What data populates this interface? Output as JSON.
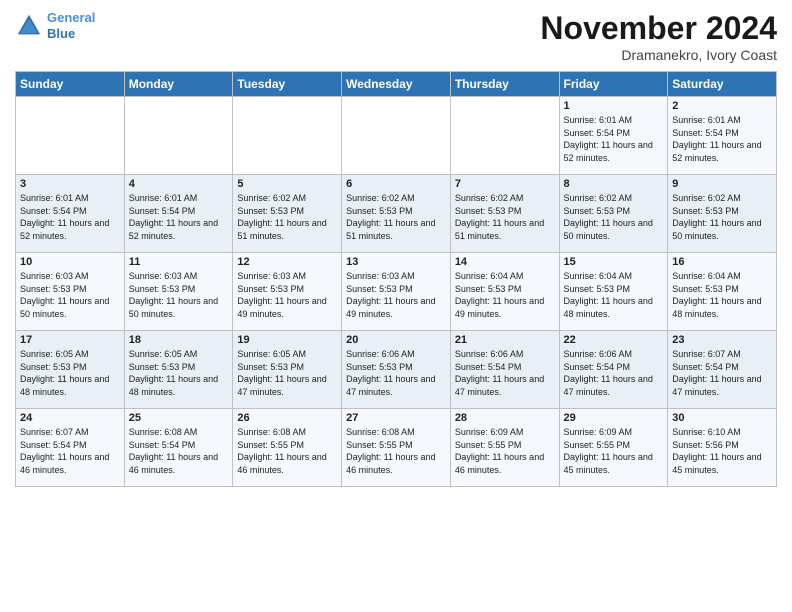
{
  "logo": {
    "line1": "General",
    "line2": "Blue"
  },
  "title": "November 2024",
  "subtitle": "Dramanekro, Ivory Coast",
  "days_of_week": [
    "Sunday",
    "Monday",
    "Tuesday",
    "Wednesday",
    "Thursday",
    "Friday",
    "Saturday"
  ],
  "weeks": [
    [
      {
        "day": "",
        "sunrise": "",
        "sunset": "",
        "daylight": ""
      },
      {
        "day": "",
        "sunrise": "",
        "sunset": "",
        "daylight": ""
      },
      {
        "day": "",
        "sunrise": "",
        "sunset": "",
        "daylight": ""
      },
      {
        "day": "",
        "sunrise": "",
        "sunset": "",
        "daylight": ""
      },
      {
        "day": "",
        "sunrise": "",
        "sunset": "",
        "daylight": ""
      },
      {
        "day": "1",
        "sunrise": "6:01 AM",
        "sunset": "5:54 PM",
        "daylight": "11 hours and 52 minutes."
      },
      {
        "day": "2",
        "sunrise": "6:01 AM",
        "sunset": "5:54 PM",
        "daylight": "11 hours and 52 minutes."
      }
    ],
    [
      {
        "day": "3",
        "sunrise": "6:01 AM",
        "sunset": "5:54 PM",
        "daylight": "11 hours and 52 minutes."
      },
      {
        "day": "4",
        "sunrise": "6:01 AM",
        "sunset": "5:54 PM",
        "daylight": "11 hours and 52 minutes."
      },
      {
        "day": "5",
        "sunrise": "6:02 AM",
        "sunset": "5:53 PM",
        "daylight": "11 hours and 51 minutes."
      },
      {
        "day": "6",
        "sunrise": "6:02 AM",
        "sunset": "5:53 PM",
        "daylight": "11 hours and 51 minutes."
      },
      {
        "day": "7",
        "sunrise": "6:02 AM",
        "sunset": "5:53 PM",
        "daylight": "11 hours and 51 minutes."
      },
      {
        "day": "8",
        "sunrise": "6:02 AM",
        "sunset": "5:53 PM",
        "daylight": "11 hours and 50 minutes."
      },
      {
        "day": "9",
        "sunrise": "6:02 AM",
        "sunset": "5:53 PM",
        "daylight": "11 hours and 50 minutes."
      }
    ],
    [
      {
        "day": "10",
        "sunrise": "6:03 AM",
        "sunset": "5:53 PM",
        "daylight": "11 hours and 50 minutes."
      },
      {
        "day": "11",
        "sunrise": "6:03 AM",
        "sunset": "5:53 PM",
        "daylight": "11 hours and 50 minutes."
      },
      {
        "day": "12",
        "sunrise": "6:03 AM",
        "sunset": "5:53 PM",
        "daylight": "11 hours and 49 minutes."
      },
      {
        "day": "13",
        "sunrise": "6:03 AM",
        "sunset": "5:53 PM",
        "daylight": "11 hours and 49 minutes."
      },
      {
        "day": "14",
        "sunrise": "6:04 AM",
        "sunset": "5:53 PM",
        "daylight": "11 hours and 49 minutes."
      },
      {
        "day": "15",
        "sunrise": "6:04 AM",
        "sunset": "5:53 PM",
        "daylight": "11 hours and 48 minutes."
      },
      {
        "day": "16",
        "sunrise": "6:04 AM",
        "sunset": "5:53 PM",
        "daylight": "11 hours and 48 minutes."
      }
    ],
    [
      {
        "day": "17",
        "sunrise": "6:05 AM",
        "sunset": "5:53 PM",
        "daylight": "11 hours and 48 minutes."
      },
      {
        "day": "18",
        "sunrise": "6:05 AM",
        "sunset": "5:53 PM",
        "daylight": "11 hours and 48 minutes."
      },
      {
        "day": "19",
        "sunrise": "6:05 AM",
        "sunset": "5:53 PM",
        "daylight": "11 hours and 47 minutes."
      },
      {
        "day": "20",
        "sunrise": "6:06 AM",
        "sunset": "5:53 PM",
        "daylight": "11 hours and 47 minutes."
      },
      {
        "day": "21",
        "sunrise": "6:06 AM",
        "sunset": "5:54 PM",
        "daylight": "11 hours and 47 minutes."
      },
      {
        "day": "22",
        "sunrise": "6:06 AM",
        "sunset": "5:54 PM",
        "daylight": "11 hours and 47 minutes."
      },
      {
        "day": "23",
        "sunrise": "6:07 AM",
        "sunset": "5:54 PM",
        "daylight": "11 hours and 47 minutes."
      }
    ],
    [
      {
        "day": "24",
        "sunrise": "6:07 AM",
        "sunset": "5:54 PM",
        "daylight": "11 hours and 46 minutes."
      },
      {
        "day": "25",
        "sunrise": "6:08 AM",
        "sunset": "5:54 PM",
        "daylight": "11 hours and 46 minutes."
      },
      {
        "day": "26",
        "sunrise": "6:08 AM",
        "sunset": "5:55 PM",
        "daylight": "11 hours and 46 minutes."
      },
      {
        "day": "27",
        "sunrise": "6:08 AM",
        "sunset": "5:55 PM",
        "daylight": "11 hours and 46 minutes."
      },
      {
        "day": "28",
        "sunrise": "6:09 AM",
        "sunset": "5:55 PM",
        "daylight": "11 hours and 46 minutes."
      },
      {
        "day": "29",
        "sunrise": "6:09 AM",
        "sunset": "5:55 PM",
        "daylight": "11 hours and 45 minutes."
      },
      {
        "day": "30",
        "sunrise": "6:10 AM",
        "sunset": "5:56 PM",
        "daylight": "11 hours and 45 minutes."
      }
    ]
  ]
}
